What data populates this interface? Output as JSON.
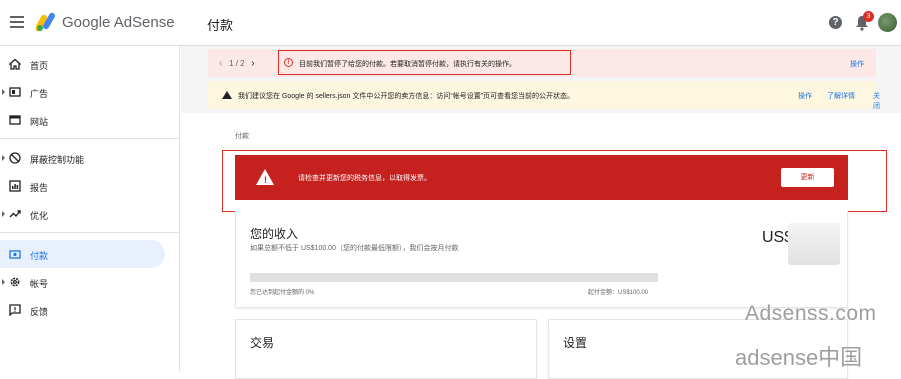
{
  "app": {
    "brand": "Google AdSense"
  },
  "header": {
    "page_title": "付款",
    "help_icon": "?",
    "notification_count": "3"
  },
  "sidebar": {
    "items": [
      {
        "label": "首页",
        "icon": "home-icon",
        "expandable": false
      },
      {
        "label": "广告",
        "icon": "ads-icon",
        "expandable": true
      },
      {
        "label": "网站",
        "icon": "sites-icon",
        "expandable": false
      },
      {
        "label": "屏蔽控制功能",
        "icon": "block-icon",
        "expandable": true
      },
      {
        "label": "报告",
        "icon": "reports-icon",
        "expandable": false
      },
      {
        "label": "优化",
        "icon": "optimize-icon",
        "expandable": true
      },
      {
        "label": "付款",
        "icon": "payments-icon",
        "expandable": false,
        "active": true
      },
      {
        "label": "帐号",
        "icon": "settings-gear-icon",
        "expandable": true
      },
      {
        "label": "反馈",
        "icon": "feedback-icon",
        "expandable": false
      }
    ]
  },
  "alerts": {
    "red": {
      "pager": "1 / 2",
      "prev_icon": "‹",
      "next_icon": "›",
      "message": "目前我们暂停了给您的付款。若要取消暂停付款，请执行有关的操作。",
      "action": "操作"
    },
    "yellow": {
      "message": "我们建议您在 Google 的 sellers.json 文件中公开您的卖方信息：访问“帐号设置”页可查看您当前的公开状态。",
      "actions": [
        "操作",
        "了解详情",
        "关闭"
      ]
    }
  },
  "content": {
    "breadcrumb": "付款",
    "update_alert": {
      "message": "请检查并更新您的税务信息，以取得发票。",
      "button": "更新"
    },
    "earnings": {
      "title": "您的收入",
      "subtitle": "如果总额不低于 US$100.00（您的付款最低限额），我们会按月付款",
      "amount": "US$",
      "progress_percent": 0,
      "progress_left": "您已达到起付金额的 0%",
      "progress_right": "起付金额：US$100.00"
    },
    "transactions": {
      "title": "交易"
    },
    "settings": {
      "title": "设置"
    }
  },
  "watermark": {
    "line1": "Adsenss.com",
    "line2": "adsense中国"
  },
  "colors": {
    "accent": "#1a73e8",
    "error": "#c5221f",
    "warning_bg": "#fef7e0",
    "error_bg": "#fce8e6"
  }
}
